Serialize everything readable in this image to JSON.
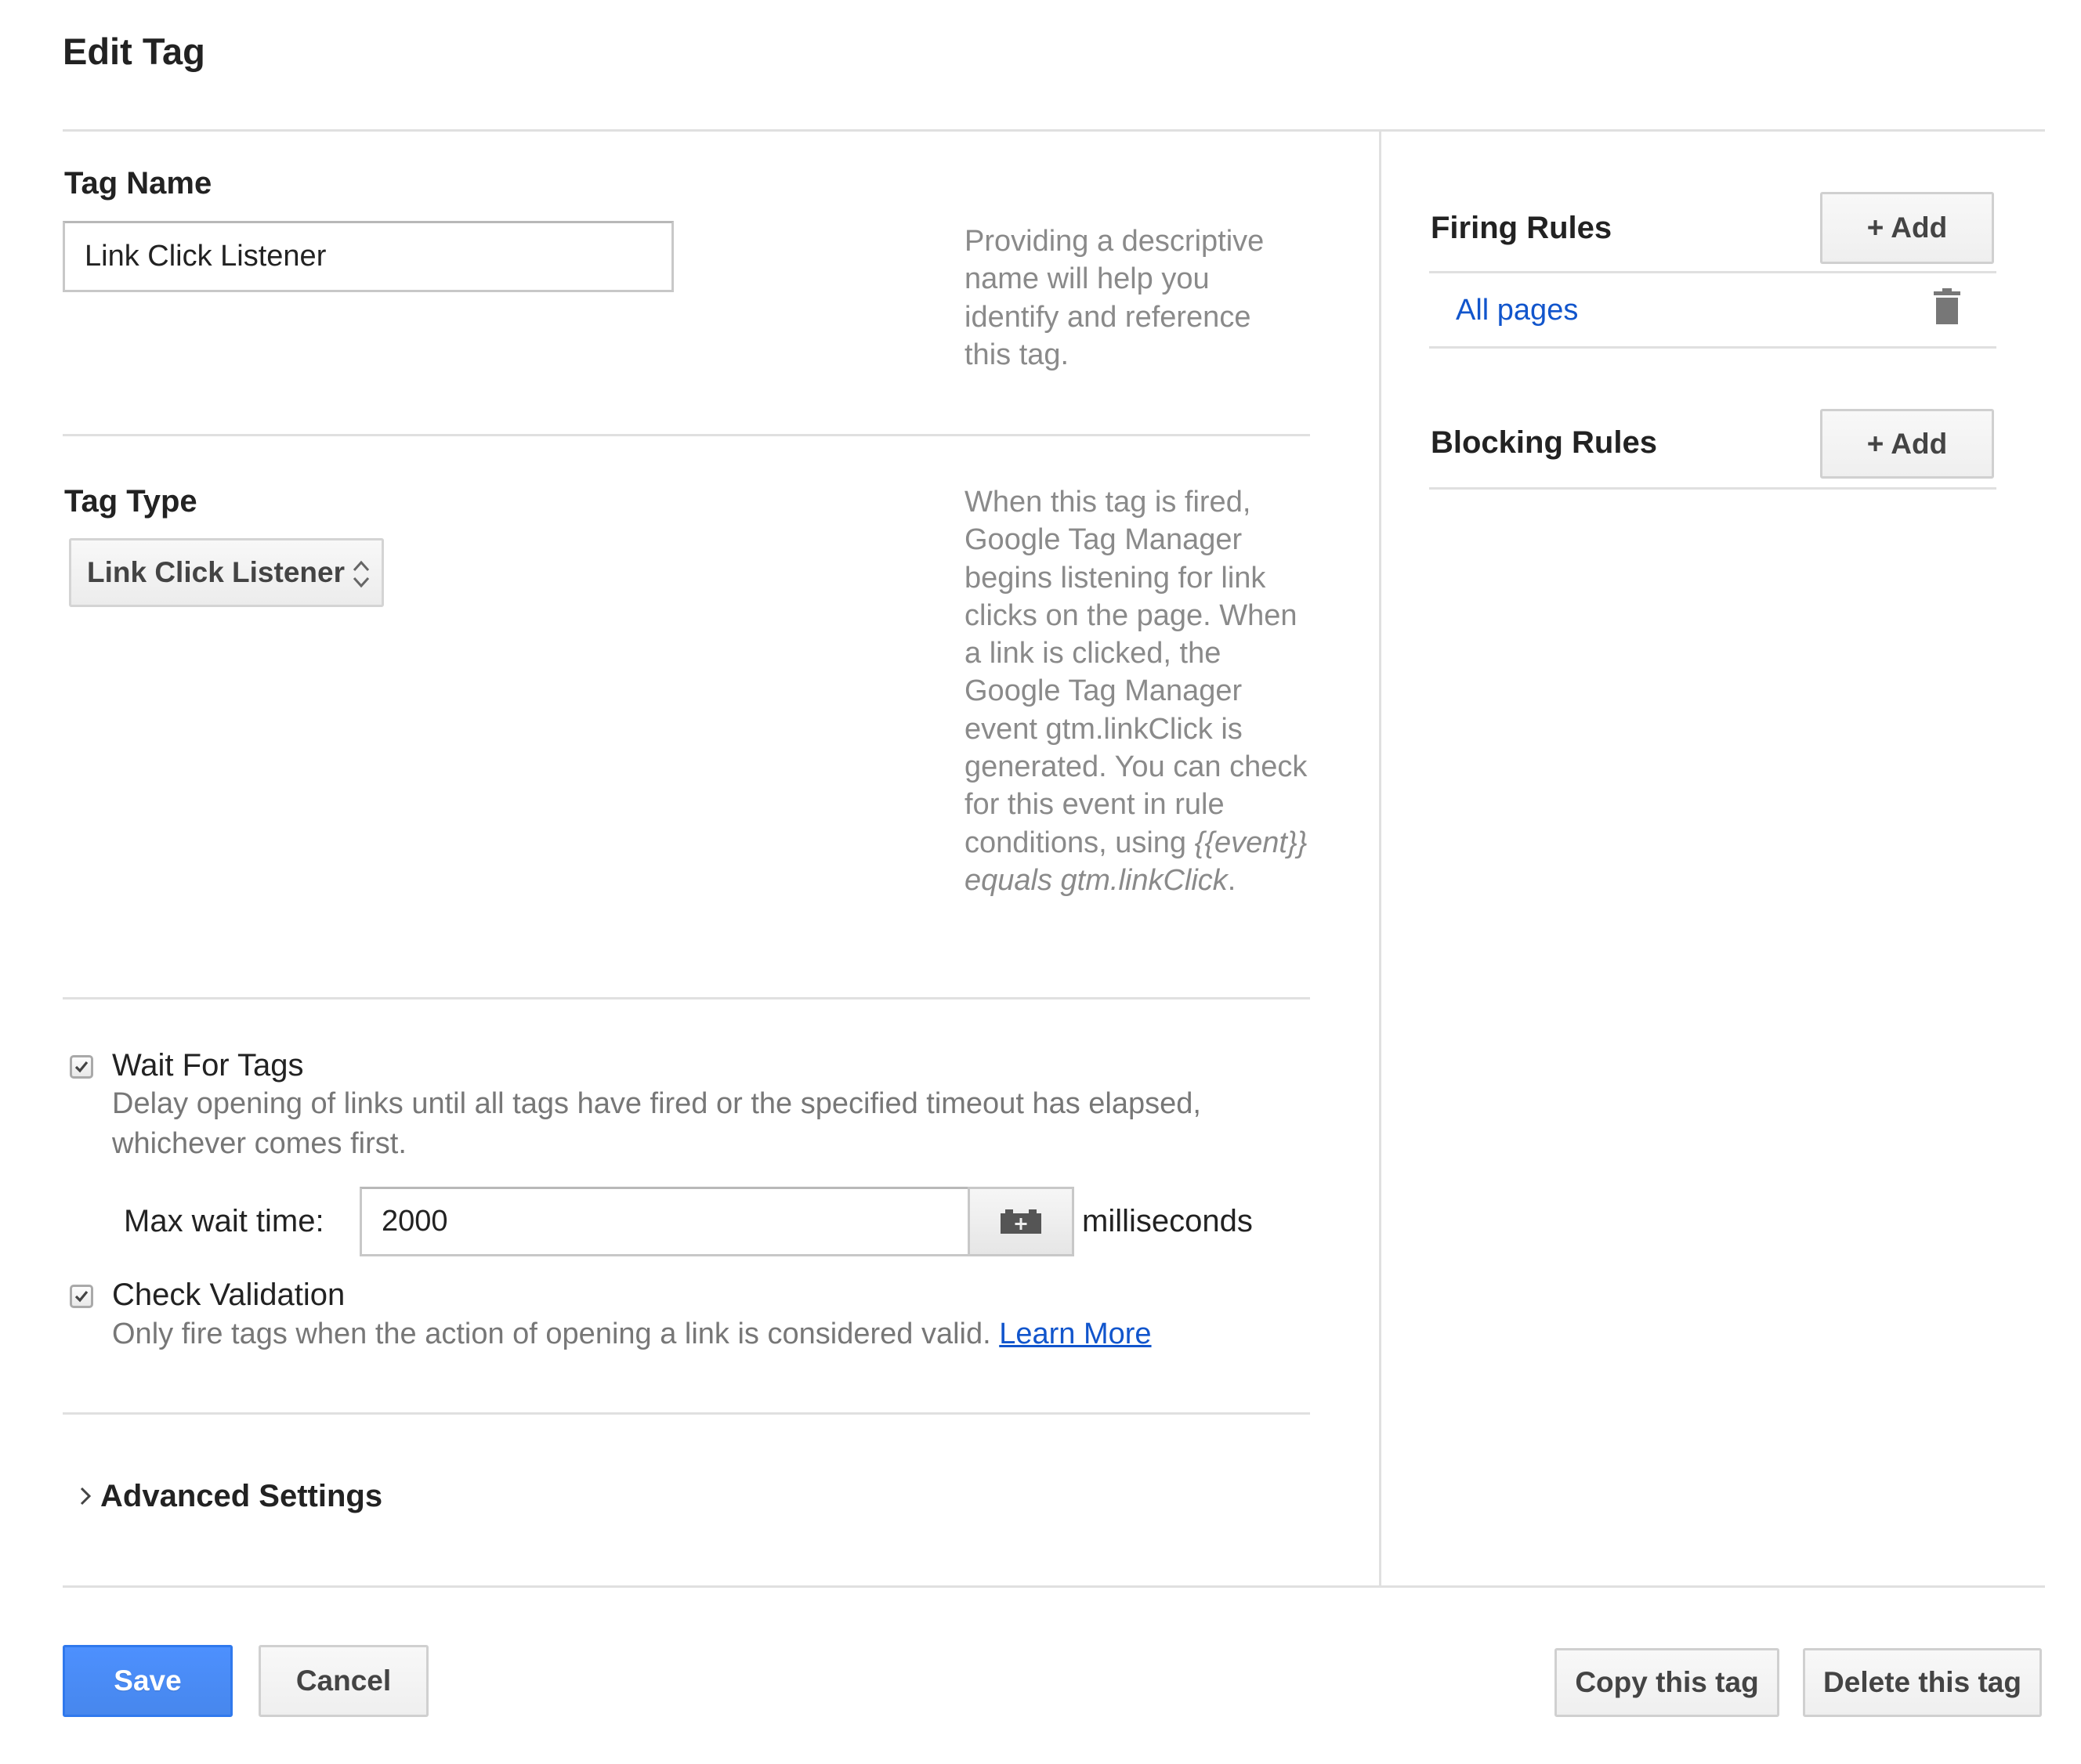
{
  "page": {
    "title": "Edit Tag"
  },
  "tag_name": {
    "label": "Tag Name",
    "value": "Link Click Listener",
    "help": "Providing a descriptive name will help you identify and reference this tag."
  },
  "tag_type": {
    "label": "Tag Type",
    "selected": "Link Click Listener",
    "help_plain": "When this tag is fired, Google Tag Manager begins listening for link clicks on the page. When a link is clicked, the Google Tag Manager event gtm.linkClick is generated. You can check for this event in rule conditions, using",
    "help_italic": "{{event}} equals gtm.linkClick",
    "help_end": "."
  },
  "wait_for_tags": {
    "checked": true,
    "label": "Wait For Tags",
    "description": "Delay opening of links until all tags have fired or the specified timeout has elapsed, whichever comes first.",
    "max_wait_label": "Max wait time:",
    "max_wait_value": "2000",
    "unit": "milliseconds"
  },
  "check_validation": {
    "checked": true,
    "label": "Check Validation",
    "description": "Only fire tags when the action of opening a link is considered valid.",
    "learn_more": "Learn More"
  },
  "advanced": {
    "label": "Advanced Settings"
  },
  "firing_rules": {
    "title": "Firing Rules",
    "add_label": "+ Add",
    "rules": [
      {
        "name": "All pages"
      }
    ]
  },
  "blocking_rules": {
    "title": "Blocking Rules",
    "add_label": "+ Add"
  },
  "footer": {
    "save_label": "Save",
    "cancel_label": "Cancel",
    "copy_label": "Copy this tag",
    "delete_label": "Delete this tag"
  },
  "colors": {
    "primary": "#4d90fe",
    "link": "#1155cc",
    "help_text": "#8a8a8a",
    "divider": "#e0e0e0"
  },
  "icons": {
    "select_arrows": "chevron-up-down-icon",
    "variable_picker": "variable-picker-icon",
    "delete_rule": "trash-icon",
    "expand": "chevron-right-icon",
    "checkbox": "checkmark-icon"
  }
}
